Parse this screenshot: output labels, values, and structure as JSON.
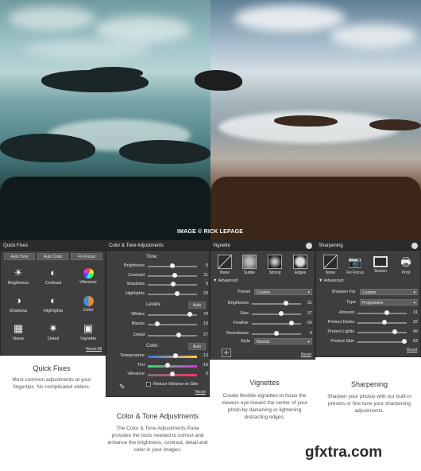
{
  "photo": {
    "credit": "IMAGE © RICK LEPAGE"
  },
  "quick_fixes": {
    "title": "Quick Fixes",
    "buttons": [
      "Auto Tone",
      "Auto Color",
      "Fix Focus"
    ],
    "cells": [
      "Brightness",
      "Contrast",
      "Vibrance",
      "Shadows",
      "Highlights",
      "Color",
      "Noise",
      "Detail",
      "Vignette"
    ],
    "reset": "Reset All"
  },
  "color_tone": {
    "title": "Color & Tone Adjustments",
    "tone_label": "Tone:",
    "tone": [
      {
        "label": "Brightness",
        "value": "0",
        "level": 0.5
      },
      {
        "label": "Contrast",
        "value": "11",
        "level": 0.55
      },
      {
        "label": "Shadows",
        "value": "5",
        "level": 0.52
      },
      {
        "label": "Highlights",
        "value": "20",
        "level": 0.6
      }
    ],
    "levels_label": "Levels:",
    "levels_auto": "Auto",
    "levels": [
      {
        "label": "Whites",
        "value": "70",
        "level": 0.85
      },
      {
        "label": "Blacks",
        "value": "10",
        "level": 0.2
      }
    ],
    "detail": {
      "label": "Detail",
      "value": "27",
      "level": 0.63
    },
    "color_label": "Color:",
    "color_auto": "Auto",
    "color": [
      {
        "label": "Temperature",
        "value": "13",
        "level": 0.56
      },
      {
        "label": "Tint",
        "value": "-19",
        "level": 0.4
      },
      {
        "label": "Vibrance",
        "value": "0",
        "level": 0.5
      }
    ],
    "reduce_vibrance": "Reduce Vibrance on Skin",
    "reset": "Reset"
  },
  "vignettes": {
    "title": "Vignette",
    "presets": [
      "None",
      "Subtle",
      "Strong",
      "Edges"
    ],
    "advanced": "Advanced",
    "preset_label": "Preset",
    "preset_value": "Custom",
    "sliders": [
      {
        "label": "Brightness",
        "value": "31",
        "level": 0.7
      },
      {
        "label": "Size",
        "value": "37",
        "level": 0.6
      },
      {
        "label": "Feather",
        "value": "65",
        "level": 0.8
      },
      {
        "label": "Roundness",
        "value": "0",
        "level": 0.5
      }
    ],
    "style_label": "Style",
    "style_value": "Normal",
    "reset": "Reset"
  },
  "sharpening": {
    "title": "Sharpening",
    "presets": [
      "None",
      "Fix Focus",
      "Screen",
      "Print"
    ],
    "advanced": "Advanced",
    "sharpen_for_label": "Sharpen For",
    "sharpen_for_value": "Custom",
    "type_label": "Type",
    "type_value": "Progressive",
    "sliders": [
      {
        "label": "Amount",
        "value": "31",
        "level": 0.6
      },
      {
        "label": "Protect Darks",
        "value": "22",
        "level": 0.55
      },
      {
        "label": "Protect Lights",
        "value": "49",
        "level": 0.75
      },
      {
        "label": "Protect Skin",
        "value": "93",
        "level": 0.95
      }
    ],
    "reset": "Reset"
  },
  "captions": {
    "quick_fixes": {
      "heading": "Quick Fixes",
      "text": "Most common adjustments at your fingertips. No complicated sliders."
    },
    "color_tone": {
      "heading": "Color & Tone Adjustments",
      "text": "The Color & Tone Adjustments Pane provides the tools needed to correct and enhance the brightness, contrast, detail and color in your images."
    },
    "vignettes": {
      "heading": "Vignettes",
      "text": "Create flexible vignettes to focus the viewers eye toward the center of your photo by darkening or lightening distracting edges."
    },
    "sharpening": {
      "heading": "Sharpening",
      "text": "Sharpen your photos with our built-in presets or fine tune your sharpening adjustments."
    }
  },
  "watermark": "gfxtra.com"
}
